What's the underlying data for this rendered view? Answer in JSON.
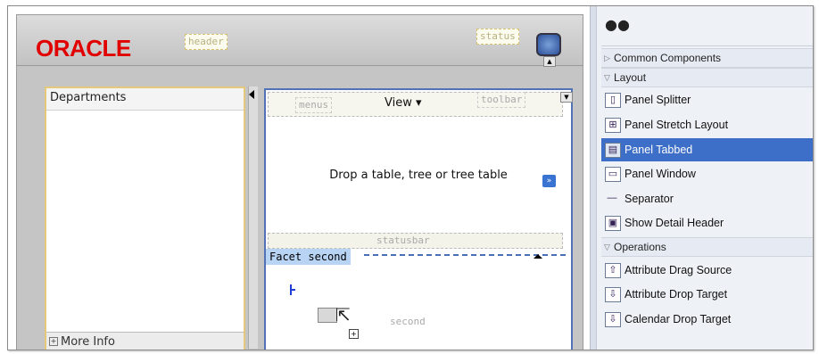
{
  "editor": {
    "logo": "ORACLE",
    "header_tag": "header",
    "status_tag": "status",
    "departments_title": "Departments",
    "more_info": "More Info",
    "menus_tag": "menus",
    "view_menu": "View ▾",
    "toolbar_tag": "toolbar",
    "drop_hint": "Drop a table, tree or tree table",
    "statusbar_tag": "statusbar",
    "facet_label": "Facet  second",
    "second_tag": "second"
  },
  "palette": {
    "sections": [
      {
        "label": "Common Components"
      },
      {
        "label": "Layout"
      },
      {
        "label": "Operations"
      }
    ],
    "layout_items": [
      {
        "label": "Panel Splitter",
        "icon": "panel-splitter-icon"
      },
      {
        "label": "Panel Stretch Layout",
        "icon": "panel-stretch-layout-icon"
      },
      {
        "label": "Panel Tabbed",
        "icon": "panel-tabbed-icon",
        "selected": true
      },
      {
        "label": "Panel Window",
        "icon": "panel-window-icon"
      },
      {
        "label": "Separator",
        "icon": "separator-icon"
      },
      {
        "label": "Show Detail Header",
        "icon": "show-detail-header-icon"
      }
    ],
    "operation_items": [
      {
        "label": "Attribute Drag Source",
        "icon": "attribute-drag-source-icon"
      },
      {
        "label": "Attribute Drop Target",
        "icon": "attribute-drop-target-icon"
      },
      {
        "label": "Calendar Drop Target",
        "icon": "calendar-drop-target-icon"
      }
    ],
    "selection_color": "#3d6ec8"
  }
}
